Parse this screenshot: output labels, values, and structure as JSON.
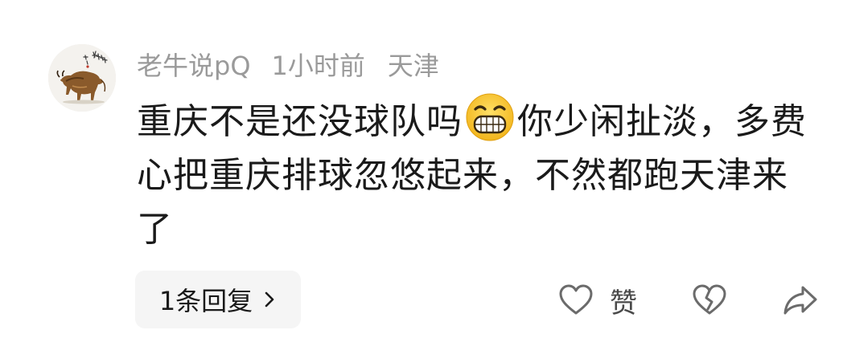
{
  "comment": {
    "username": "老牛说pQ",
    "time": "1小时前",
    "location": "天津",
    "text_before_emoji": "重庆不是还没球队吗",
    "emoji": "grinning-face-icon",
    "text_after_emoji": "你少闲扯淡，多费心把重庆排球忽悠起来，不然都跑天津来了"
  },
  "actions": {
    "reply_label": "1条回复",
    "like_label": "赞"
  },
  "colors": {
    "meta_text": "#9a9a9a",
    "body_text": "#1a1a1a",
    "reply_bg": "#f5f5f5",
    "icon_stroke": "#6b6b6b",
    "emoji_yellow": "#f7c531"
  }
}
